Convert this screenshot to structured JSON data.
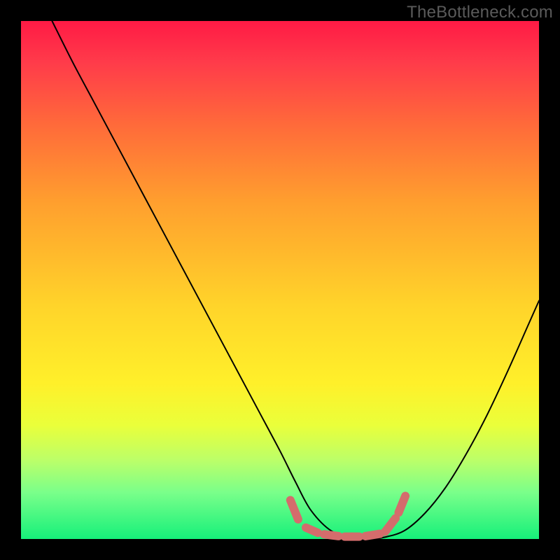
{
  "watermark": "TheBottleneck.com",
  "colors": {
    "frame_bg": "#000000",
    "line": "#000000",
    "marker": "#d46c6c",
    "gradient_stops": [
      "#ff1a45",
      "#ff3b4a",
      "#ff6a3a",
      "#ff9f2e",
      "#ffd42a",
      "#fff02a",
      "#eaff3a",
      "#baff6a",
      "#7aff8a",
      "#16f07a"
    ]
  },
  "chart_data": {
    "type": "line",
    "title": "",
    "xlabel": "",
    "ylabel": "",
    "xlim": [
      0,
      100
    ],
    "ylim": [
      0,
      100
    ],
    "grid": false,
    "series": [
      {
        "name": "curve",
        "x": [
          6,
          10,
          14,
          18,
          22,
          26,
          30,
          34,
          38,
          42,
          46,
          50,
          53,
          56,
          60,
          64,
          68,
          70,
          74,
          78,
          82,
          86,
          90,
          94,
          98,
          100
        ],
        "values": [
          100,
          92,
          84.5,
          77,
          69.5,
          62,
          54.5,
          47,
          39.5,
          32,
          24.5,
          17,
          11,
          5.5,
          1.5,
          0.3,
          0.1,
          0.3,
          1.6,
          5,
          10,
          16.5,
          24,
          32.5,
          41.5,
          46
        ]
      }
    ],
    "markers": {
      "name": "valley-dashes",
      "segments": [
        {
          "x1": 52.0,
          "y1": 7.5,
          "x2": 53.5,
          "y2": 3.8
        },
        {
          "x1": 55.0,
          "y1": 2.2,
          "x2": 57.3,
          "y2": 1.2
        },
        {
          "x1": 58.5,
          "y1": 0.9,
          "x2": 61.3,
          "y2": 0.55
        },
        {
          "x1": 62.5,
          "y1": 0.45,
          "x2": 65.3,
          "y2": 0.45
        },
        {
          "x1": 66.5,
          "y1": 0.55,
          "x2": 69.3,
          "y2": 1.0
        },
        {
          "x1": 70.3,
          "y1": 1.4,
          "x2": 72.3,
          "y2": 4.0
        },
        {
          "x1": 72.9,
          "y1": 5.1,
          "x2": 74.2,
          "y2": 8.3
        }
      ]
    }
  }
}
